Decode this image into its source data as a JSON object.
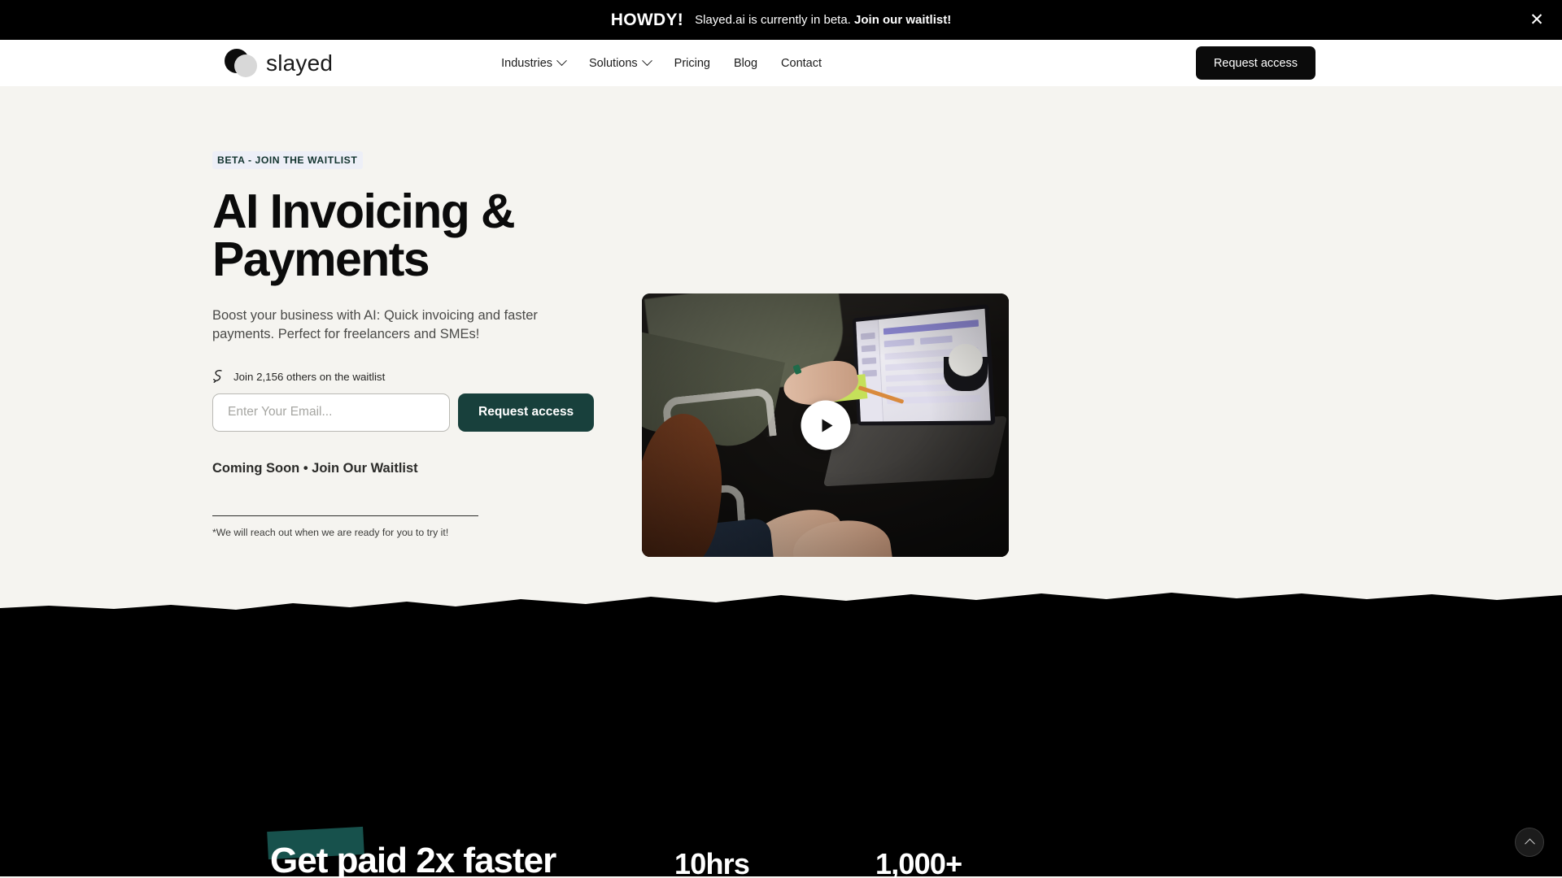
{
  "announcement": {
    "howdy": "HOWDY!",
    "message": "Slayed.ai is currently in beta. ",
    "message_bold": "Join our waitlist!",
    "close_icon": "close-icon"
  },
  "header": {
    "logo_text": "slayed",
    "nav": [
      {
        "label": "Industries",
        "has_dropdown": true
      },
      {
        "label": "Solutions",
        "has_dropdown": true
      },
      {
        "label": "Pricing",
        "has_dropdown": false
      },
      {
        "label": "Blog",
        "has_dropdown": false
      },
      {
        "label": "Contact",
        "has_dropdown": false
      }
    ],
    "cta_label": "Request access"
  },
  "hero": {
    "badge": "BETA - JOIN THE WAITLIST",
    "title_line1": "AI Invoicing &",
    "title_line2": "Payments",
    "subtitle_line1": "Boost your business with AI: Quick invoicing and faster payments.",
    "subtitle_line2": "Perfect for freelancers and SMEs!",
    "joined_icon": "squiggly-arrow-icon",
    "joined_text": "Join 2,156 others on the waitlist",
    "email_placeholder": "Enter Your Email...",
    "email_value": "",
    "submit_label": "Request access",
    "coming_soon": "Coming Soon • Join Our Waitlist",
    "footnote": "*We will reach out when we are ready for you to try it!",
    "media_alt": "team-collaborating-at-desk-with-laptop",
    "play_icon": "play-icon"
  },
  "dark_section": {
    "headline": "Get paid 2x faster",
    "highlight_word": "Get",
    "stats": [
      {
        "value": "10hrs"
      },
      {
        "value": "1,000+"
      }
    ],
    "scroll_top_icon": "chevron-up-icon"
  },
  "colors": {
    "page_bg": "#F5F4F0",
    "accent_teal": "#18403C",
    "highlight_teal": "#17514C",
    "badge_bg": "#EDEFF7",
    "dark": "#000000"
  }
}
